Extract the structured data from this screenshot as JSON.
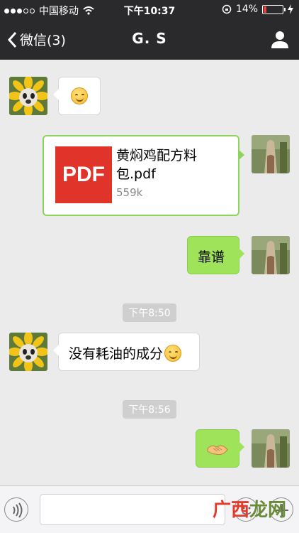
{
  "status_bar": {
    "carrier": "中国移动",
    "time": "下午10:37",
    "battery_percent": "14%",
    "battery_level": 0.14
  },
  "nav": {
    "back_label": "微信(3)",
    "title": "G. S"
  },
  "messages": {
    "file": {
      "type_label": "PDF",
      "name_line1": "黄焖鸡配方料",
      "name_line2": "包.pdf",
      "size": "559k"
    },
    "reply_1": "靠谱",
    "timestamp_1": "下午8:50",
    "received_2": "没有耗油的成分",
    "timestamp_2": "下午8:56"
  },
  "watermark": {
    "part1": "广西",
    "part2": "龙网"
  },
  "colors": {
    "nav_bg": "#2a2a2c",
    "chat_bg": "#ebebeb",
    "sent_bubble": "#9fe35b",
    "pdf_red": "#e0342a"
  }
}
